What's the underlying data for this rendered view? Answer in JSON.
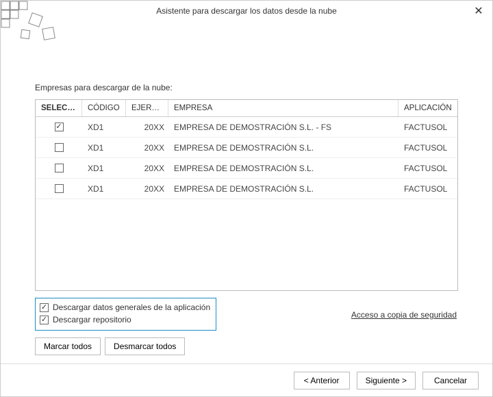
{
  "window": {
    "title": "Asistente para descargar los datos desde la nube"
  },
  "section_label": "Empresas para descargar de la nube:",
  "table": {
    "headers": {
      "seleccion": "SELECCI...",
      "codigo": "CÓDIGO",
      "ejercicio": "EJERCICIO",
      "empresa": "EMPRESA",
      "aplicacion": "APLICACIÓN"
    },
    "rows": [
      {
        "selected": true,
        "codigo": "XD1",
        "ejercicio": "20XX",
        "empresa": "EMPRESA DE DEMOSTRACIÓN S.L. - FS",
        "aplicacion": "FACTUSOL"
      },
      {
        "selected": false,
        "codigo": "XD1",
        "ejercicio": "20XX",
        "empresa": "EMPRESA DE DEMOSTRACIÓN S.L.",
        "aplicacion": "FACTUSOL"
      },
      {
        "selected": false,
        "codigo": "XD1",
        "ejercicio": "20XX",
        "empresa": "EMPRESA DE DEMOSTRACIÓN S.L.",
        "aplicacion": "FACTUSOL"
      },
      {
        "selected": false,
        "codigo": "XD1",
        "ejercicio": "20XX",
        "empresa": "EMPRESA DE DEMOSTRACIÓN S.L.",
        "aplicacion": "FACTUSOL"
      }
    ]
  },
  "options": {
    "opt1": {
      "label": "Descargar datos generales de la aplicación",
      "checked": true
    },
    "opt2": {
      "label": "Descargar repositorio",
      "checked": true
    }
  },
  "buttons": {
    "mark_all": "Marcar todos",
    "unmark_all": "Desmarcar todos",
    "backup_link": "Acceso a copia de seguridad",
    "back": "< Anterior",
    "next": "Siguiente >",
    "cancel": "Cancelar"
  },
  "colors": {
    "highlight_border": "#1b8bc4"
  }
}
